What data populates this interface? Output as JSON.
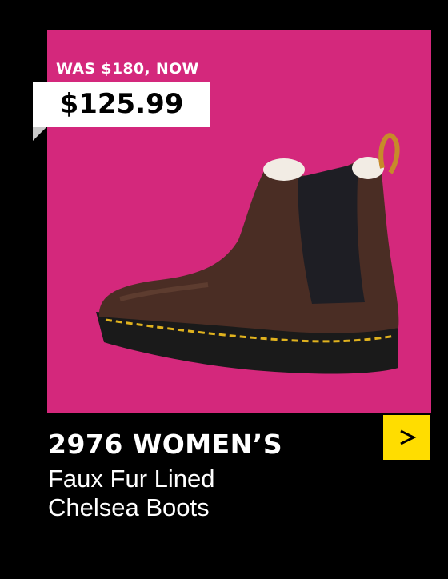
{
  "promo": {
    "was_label": "WAS $180, NOW",
    "price": "$125.99"
  },
  "product": {
    "title": "2976 WOMEN’S",
    "subtitle_line1": "Faux Fur Lined",
    "subtitle_line2": "Chelsea Boots",
    "image_icon": "chelsea-boot-image"
  },
  "colors": {
    "background": "#000000",
    "card": "#d4287c",
    "accent": "#ffdd00",
    "price_box": "#ffffff"
  },
  "cta": {
    "icon": "chevron-right-icon"
  }
}
